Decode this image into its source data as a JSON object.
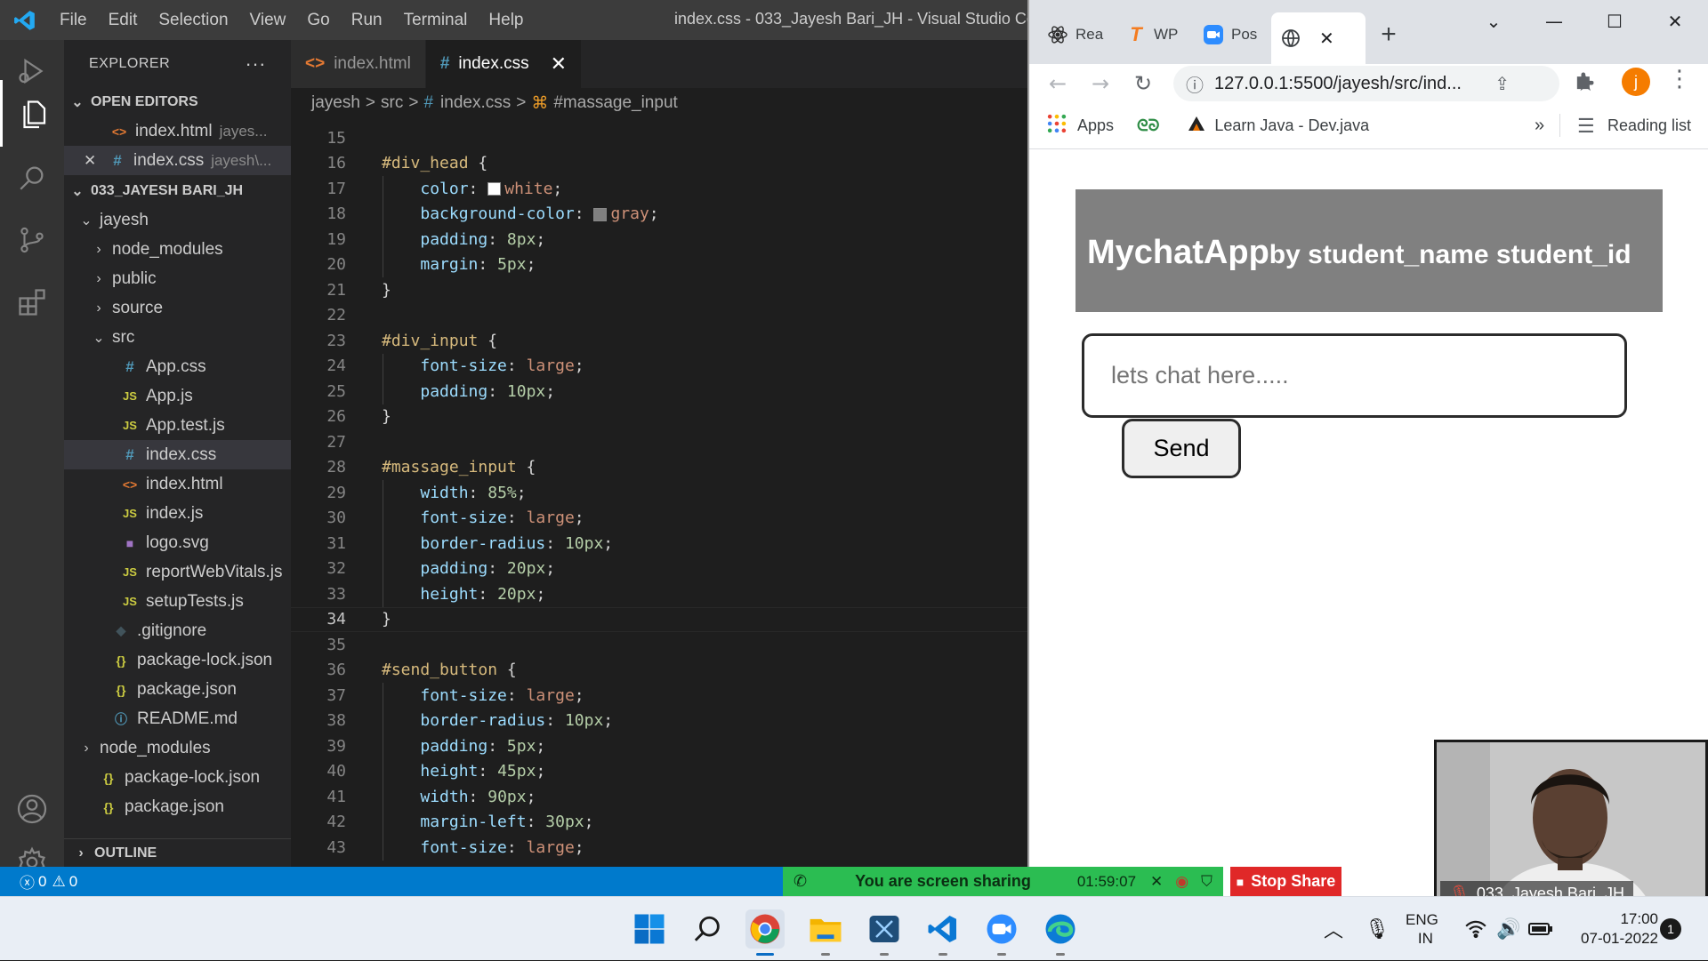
{
  "vscode": {
    "menu": [
      "File",
      "Edit",
      "Selection",
      "View",
      "Go",
      "Run",
      "Terminal",
      "Help"
    ],
    "window_title": "index.css - 033_Jayesh Bari_JH - Visual Studio Cod",
    "explorer": {
      "header": "EXPLORER",
      "more": "···",
      "open_editors_label": "OPEN EDITORS",
      "open_editors": [
        {
          "name": "index.html",
          "detail": "jayes...",
          "icon": "<>"
        },
        {
          "name": "index.css",
          "detail": "jayesh\\...",
          "icon": "#"
        }
      ],
      "project_label": "033_JAYESH BARI_JH",
      "tree": [
        {
          "name": "jayesh",
          "icon": "",
          "level": 1
        },
        {
          "name": "node_modules",
          "icon": "",
          "level": 2
        },
        {
          "name": "public",
          "icon": "",
          "level": 2
        },
        {
          "name": "source",
          "icon": "",
          "level": 2
        },
        {
          "name": "src",
          "icon": "",
          "level": 2
        },
        {
          "name": "App.css",
          "icon": "#",
          "level": 3
        },
        {
          "name": "App.js",
          "icon": "JS",
          "level": 3
        },
        {
          "name": "App.test.js",
          "icon": "JS",
          "level": 3
        },
        {
          "name": "index.css",
          "icon": "#",
          "level": 3
        },
        {
          "name": "index.html",
          "icon": "<>",
          "level": 3
        },
        {
          "name": "index.js",
          "icon": "JS",
          "level": 3
        },
        {
          "name": "logo.svg",
          "icon": "■",
          "level": 3
        },
        {
          "name": "reportWebVitals.js",
          "icon": "JS",
          "level": 3
        },
        {
          "name": "setupTests.js",
          "icon": "JS",
          "level": 3
        },
        {
          "name": ".gitignore",
          "icon": "◆",
          "level": 2
        },
        {
          "name": "package-lock.json",
          "icon": "{}",
          "level": 2
        },
        {
          "name": "package.json",
          "icon": "{}",
          "level": 2
        },
        {
          "name": "README.md",
          "icon": "ⓘ",
          "level": 2
        },
        {
          "name": "node_modules",
          "icon": "",
          "level": 1
        },
        {
          "name": "package-lock.json",
          "icon": "{}",
          "level": 1
        },
        {
          "name": "package.json",
          "icon": "{}",
          "level": 1
        }
      ],
      "outline_label": "OUTLINE"
    },
    "tabs": [
      {
        "label": "index.html",
        "icon": "<>"
      },
      {
        "label": "index.css",
        "icon": "#",
        "close": "✕"
      }
    ],
    "breadcrumb": [
      "jayesh",
      "src",
      "index.css",
      "#massage_input"
    ],
    "breadcrumb_sep": ">",
    "code": {
      "current_line": 34,
      "lines": [
        {
          "n": 15,
          "parts": []
        },
        {
          "n": 16,
          "parts": [
            [
              "sel",
              "#div_head"
            ],
            [
              "p",
              " {"
            ]
          ]
        },
        {
          "n": 17,
          "parts": [
            [
              "ind",
              "    "
            ],
            [
              "prop",
              "color"
            ],
            [
              "p",
              ": "
            ],
            [
              "swatch",
              "#ffffff"
            ],
            [
              "val",
              "white"
            ],
            [
              "p",
              ";"
            ]
          ]
        },
        {
          "n": 18,
          "parts": [
            [
              "ind",
              "    "
            ],
            [
              "prop",
              "background-color"
            ],
            [
              "p",
              ": "
            ],
            [
              "swatch",
              "#808080"
            ],
            [
              "val",
              "gray"
            ],
            [
              "p",
              ";"
            ]
          ]
        },
        {
          "n": 19,
          "parts": [
            [
              "ind",
              "    "
            ],
            [
              "prop",
              "padding"
            ],
            [
              "p",
              ": "
            ],
            [
              "num",
              "8px"
            ],
            [
              "p",
              ";"
            ]
          ]
        },
        {
          "n": 20,
          "parts": [
            [
              "ind",
              "    "
            ],
            [
              "prop",
              "margin"
            ],
            [
              "p",
              ": "
            ],
            [
              "num",
              "5px"
            ],
            [
              "p",
              ";"
            ]
          ]
        },
        {
          "n": 21,
          "parts": [
            [
              "p",
              "}"
            ]
          ]
        },
        {
          "n": 22,
          "parts": []
        },
        {
          "n": 23,
          "parts": [
            [
              "sel",
              "#div_input"
            ],
            [
              "p",
              " {"
            ]
          ]
        },
        {
          "n": 24,
          "parts": [
            [
              "ind",
              "    "
            ],
            [
              "prop",
              "font-size"
            ],
            [
              "p",
              ": "
            ],
            [
              "val",
              "large"
            ],
            [
              "p",
              ";"
            ]
          ]
        },
        {
          "n": 25,
          "parts": [
            [
              "ind",
              "    "
            ],
            [
              "prop",
              "padding"
            ],
            [
              "p",
              ": "
            ],
            [
              "num",
              "10px"
            ],
            [
              "p",
              ";"
            ]
          ]
        },
        {
          "n": 26,
          "parts": [
            [
              "p",
              "}"
            ]
          ]
        },
        {
          "n": 27,
          "parts": []
        },
        {
          "n": 28,
          "parts": [
            [
              "sel",
              "#massage_input"
            ],
            [
              "p",
              " {"
            ]
          ]
        },
        {
          "n": 29,
          "parts": [
            [
              "ind",
              "    "
            ],
            [
              "prop",
              "width"
            ],
            [
              "p",
              ": "
            ],
            [
              "num",
              "85%"
            ],
            [
              "p",
              ";"
            ]
          ]
        },
        {
          "n": 30,
          "parts": [
            [
              "ind",
              "    "
            ],
            [
              "prop",
              "font-size"
            ],
            [
              "p",
              ": "
            ],
            [
              "val",
              "large"
            ],
            [
              "p",
              ";"
            ]
          ]
        },
        {
          "n": 31,
          "parts": [
            [
              "ind",
              "    "
            ],
            [
              "prop",
              "border-radius"
            ],
            [
              "p",
              ": "
            ],
            [
              "num",
              "10px"
            ],
            [
              "p",
              ";"
            ]
          ]
        },
        {
          "n": 32,
          "parts": [
            [
              "ind",
              "    "
            ],
            [
              "prop",
              "padding"
            ],
            [
              "p",
              ": "
            ],
            [
              "num",
              "20px"
            ],
            [
              "p",
              ";"
            ]
          ]
        },
        {
          "n": 33,
          "parts": [
            [
              "ind",
              "    "
            ],
            [
              "prop",
              "height"
            ],
            [
              "p",
              ": "
            ],
            [
              "num",
              "20px"
            ],
            [
              "p",
              ";"
            ]
          ]
        },
        {
          "n": 34,
          "parts": [
            [
              "p",
              "}"
            ]
          ]
        },
        {
          "n": 35,
          "parts": []
        },
        {
          "n": 36,
          "parts": [
            [
              "sel",
              "#send_button"
            ],
            [
              "p",
              " {"
            ]
          ]
        },
        {
          "n": 37,
          "parts": [
            [
              "ind",
              "    "
            ],
            [
              "prop",
              "font-size"
            ],
            [
              "p",
              ": "
            ],
            [
              "val",
              "large"
            ],
            [
              "p",
              ";"
            ]
          ]
        },
        {
          "n": 38,
          "parts": [
            [
              "ind",
              "    "
            ],
            [
              "prop",
              "border-radius"
            ],
            [
              "p",
              ": "
            ],
            [
              "num",
              "10px"
            ],
            [
              "p",
              ";"
            ]
          ]
        },
        {
          "n": 39,
          "parts": [
            [
              "ind",
              "    "
            ],
            [
              "prop",
              "padding"
            ],
            [
              "p",
              ": "
            ],
            [
              "num",
              "5px"
            ],
            [
              "p",
              ";"
            ]
          ]
        },
        {
          "n": 40,
          "parts": [
            [
              "ind",
              "    "
            ],
            [
              "prop",
              "height"
            ],
            [
              "p",
              ": "
            ],
            [
              "num",
              "45px"
            ],
            [
              "p",
              ";"
            ]
          ]
        },
        {
          "n": 41,
          "parts": [
            [
              "ind",
              "    "
            ],
            [
              "prop",
              "width"
            ],
            [
              "p",
              ": "
            ],
            [
              "num",
              "90px"
            ],
            [
              "p",
              ";"
            ]
          ]
        },
        {
          "n": 42,
          "parts": [
            [
              "ind",
              "    "
            ],
            [
              "prop",
              "margin-left"
            ],
            [
              "p",
              ": "
            ],
            [
              "num",
              "30px"
            ],
            [
              "p",
              ";"
            ]
          ]
        },
        {
          "n": 43,
          "parts": [
            [
              "ind",
              "    "
            ],
            [
              "prop",
              "font-size"
            ],
            [
              "p",
              ": "
            ],
            [
              "val",
              "large"
            ],
            [
              "p",
              ";"
            ]
          ]
        }
      ]
    },
    "status": {
      "errors": "0",
      "warnings": "0"
    }
  },
  "chrome": {
    "tabs": [
      {
        "label": "Rea",
        "icon": "react-icon"
      },
      {
        "label": "WP",
        "icon": "wp-icon"
      },
      {
        "label": "Pos",
        "icon": "zoom-icon"
      },
      {
        "label": "",
        "icon": "globe-icon",
        "active": true,
        "close": "✕"
      }
    ],
    "new_tab": "+",
    "url": "127.0.0.1:5500/jayesh/src/ind...",
    "avatar_letter": "j",
    "bookmarks": [
      {
        "label": "Apps",
        "icon": "apps-grid-icon"
      },
      {
        "label": "",
        "icon": "gfg-icon"
      },
      {
        "label": "Learn Java - Dev.java",
        "icon": "java-icon"
      }
    ],
    "more_bookmarks": "»",
    "reading_list": "Reading list"
  },
  "chat_app": {
    "title": "MychatApp",
    "subtitle": "by student_name student_id",
    "input_placeholder": "lets chat here.....",
    "send_label": "Send"
  },
  "zoom": {
    "sharing_text": "You are screen sharing",
    "timer": "01:59:07",
    "stop_share": "Stop Share",
    "participant_name": "033_Jayesh Bari_JH"
  },
  "taskbar": {
    "language_line1": "ENG",
    "language_line2": "IN",
    "time": "17:00",
    "date": "07-01-2022",
    "notification_count": "1"
  }
}
